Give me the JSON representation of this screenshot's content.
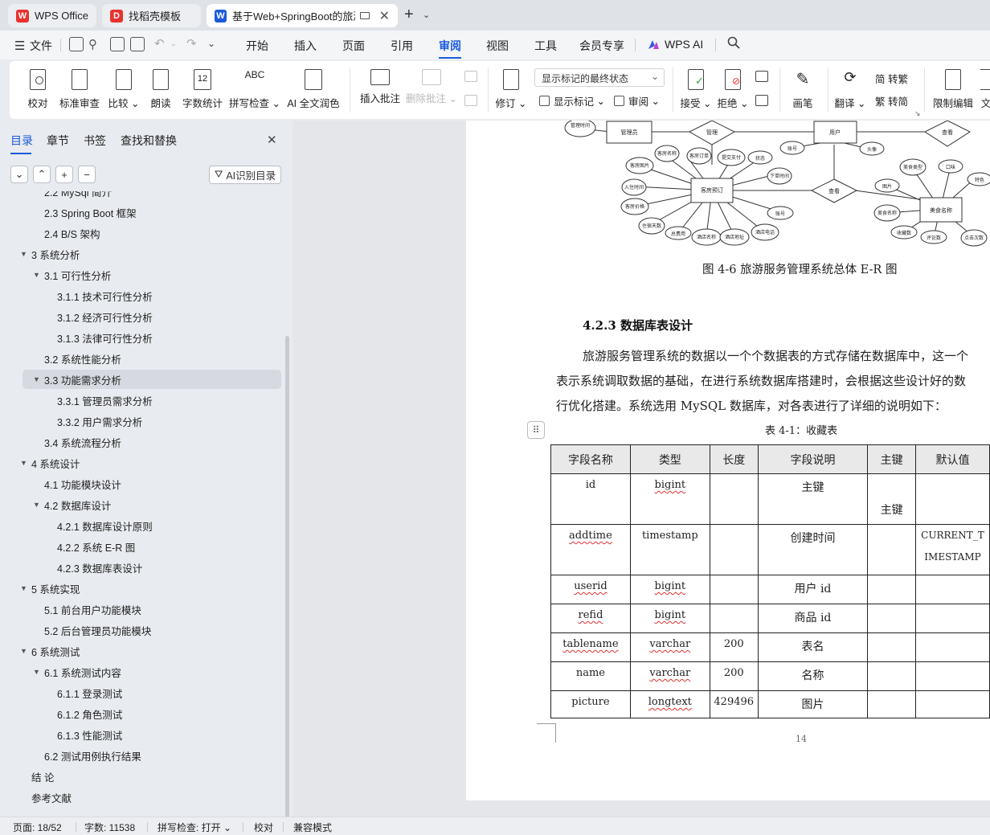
{
  "tabs": [
    {
      "label": "WPS Office",
      "icon": "wps-logo-icon",
      "color": "#e8322f"
    },
    {
      "label": "找稻壳模板",
      "icon": "docer-logo-icon",
      "color": "#e8322f"
    },
    {
      "label": "基于Web+SpringBoot的旅游",
      "icon": "word-doc-icon",
      "color": "#1a5bd8"
    }
  ],
  "menubar": {
    "file": "文件",
    "items": [
      "开始",
      "插入",
      "页面",
      "引用",
      "审阅",
      "视图",
      "工具",
      "会员专享"
    ],
    "active": "审阅",
    "wps_ai": "WPS AI"
  },
  "ribbon": {
    "proofread": "校对",
    "standard_review": "标准审查",
    "compare": "比较",
    "read_aloud": "朗读",
    "word_count": "字数统计",
    "word_count_icon_text": "12",
    "spell_check": "拼写检查",
    "spell_icon_text": "ABC",
    "ai_polish": "AI 全文润色",
    "insert_comment": "插入批注",
    "delete_comment": "删除批注",
    "track_changes": "修订",
    "markup_state": "显示标记的最终状态",
    "show_markup": "显示标记",
    "review_pane": "审阅",
    "accept": "接受",
    "reject": "拒绝",
    "ink": "画笔",
    "translate": "翻译",
    "to_traditional": "简 转繁",
    "to_simplified": "繁 转简",
    "restrict_editing": "限制编辑",
    "doc_partial": "文"
  },
  "nav": {
    "tabs": [
      "目录",
      "章节",
      "书签",
      "查找和替换"
    ],
    "active": "目录",
    "ai_toc": "AI识别目录",
    "items": [
      {
        "label": "2.2 MySql 简介",
        "level": 1
      },
      {
        "label": "2.3 Spring Boot 框架",
        "level": 1
      },
      {
        "label": "2.4 B/S 架构",
        "level": 1
      },
      {
        "label": "3 系统分析",
        "level": 0,
        "expand": true
      },
      {
        "label": "3.1 可行性分析",
        "level": 1,
        "expand": true
      },
      {
        "label": "3.1.1 技术可行性分析",
        "level": 2
      },
      {
        "label": "3.1.2 经济可行性分析",
        "level": 2
      },
      {
        "label": "3.1.3 法律可行性分析",
        "level": 2
      },
      {
        "label": "3.2 系统性能分析",
        "level": 1
      },
      {
        "label": "3.3 功能需求分析",
        "level": 1,
        "expand": true,
        "selected": true
      },
      {
        "label": "3.3.1 管理员需求分析",
        "level": 2
      },
      {
        "label": "3.3.2 用户需求分析",
        "level": 2
      },
      {
        "label": "3.4 系统流程分析",
        "level": 1
      },
      {
        "label": "4 系统设计",
        "level": 0,
        "expand": true
      },
      {
        "label": "4.1 功能模块设计",
        "level": 1
      },
      {
        "label": "4.2 数据库设计",
        "level": 1,
        "expand": true
      },
      {
        "label": "4.2.1 数据库设计原则",
        "level": 2
      },
      {
        "label": "4.2.2 系统 E-R 图",
        "level": 2
      },
      {
        "label": "4.2.3 数据库表设计",
        "level": 2
      },
      {
        "label": "5 系统实现",
        "level": 0,
        "expand": true
      },
      {
        "label": "5.1 前台用户功能模块",
        "level": 1
      },
      {
        "label": "5.2  后台管理员功能模块",
        "level": 1
      },
      {
        "label": "6 系统测试",
        "level": 0,
        "expand": true
      },
      {
        "label": "6.1 系统测试内容",
        "level": 1,
        "expand": true
      },
      {
        "label": "6.1.1 登录测试",
        "level": 2
      },
      {
        "label": "6.1.2  角色测试",
        "level": 2
      },
      {
        "label": "6.1.3    性能测试",
        "level": 2
      },
      {
        "label": "6.2 测试用例执行结果",
        "level": 1
      },
      {
        "label": "结    论",
        "level": 0
      },
      {
        "label": "参考文献",
        "level": 0
      }
    ]
  },
  "doc": {
    "er_caption": "图 4-6 旅游服务管理系统总体 E-R 图",
    "er": {
      "admin": "管理员",
      "manage": "管理",
      "user": "用户",
      "view": "查看",
      "room_booking": "客房预订",
      "food_name": "美食名称",
      "account_no": "账号",
      "avatar": "头像",
      "view2": "查看",
      "a1": "客房名称",
      "a2": "客房订单",
      "a3": "提交支付",
      "a4": "状态",
      "a5": "客房图片",
      "a6": "下单时间",
      "a7": "入住时间",
      "a8": "客房价格",
      "a9": "账号",
      "a10": "住宿天数",
      "a11": "总费用",
      "a12": "酒店名称",
      "a13": "酒店地址",
      "a14": "酒店电话",
      "b1": "美食类型",
      "b2": "口味",
      "b3": "图片",
      "b4": "特色",
      "b5": "美食名称",
      "b6": "收藏数",
      "b7": "评论数",
      "b8": "点击次数",
      "c1": "管理时间"
    },
    "heading": "4.2.3 数据库表设计",
    "para1": "旅游服务管理系统的数据以一个个数据表的方式存储在数据库中，这一个",
    "para2": "表示系统调取数据的基础，在进行系统数据库搭建时，会根据这些设计好的数",
    "para3": "行优化搭建。系统选用 MySQL 数据库，对各表进行了详细的说明如下：",
    "table_caption": "表 4-1：收藏表",
    "table": {
      "headers": [
        "字段名称",
        "类型",
        "长度",
        "字段说明",
        "主键",
        "默认值"
      ],
      "rows": [
        {
          "name": "id",
          "type": "bigint",
          "len": "",
          "desc": "主键",
          "pk": "主键",
          "def": ""
        },
        {
          "name": "addtime",
          "type": "timestamp",
          "len": "",
          "desc": "创建时间",
          "pk": "",
          "def": "CURRENT_TIMESTAMP"
        },
        {
          "name": "userid",
          "type": "bigint",
          "len": "",
          "desc": "用户 id",
          "pk": "",
          "def": ""
        },
        {
          "name": "refid",
          "type": "bigint",
          "len": "",
          "desc": "商品 id",
          "pk": "",
          "def": ""
        },
        {
          "name": "tablename",
          "type": "varchar",
          "len": "200",
          "desc": "表名",
          "pk": "",
          "def": ""
        },
        {
          "name": "name",
          "type": "varchar",
          "len": "200",
          "desc": "名称",
          "pk": "",
          "def": ""
        },
        {
          "name": "picture",
          "type": "longtext",
          "len": "429496",
          "desc": "图片",
          "pk": "",
          "def": ""
        }
      ]
    },
    "page_number": "14"
  },
  "status": {
    "page": "页面: 18/52",
    "words": "字数: 11538",
    "spell": "拼写检查: 打开",
    "proof": "校对",
    "compat": "兼容模式"
  }
}
